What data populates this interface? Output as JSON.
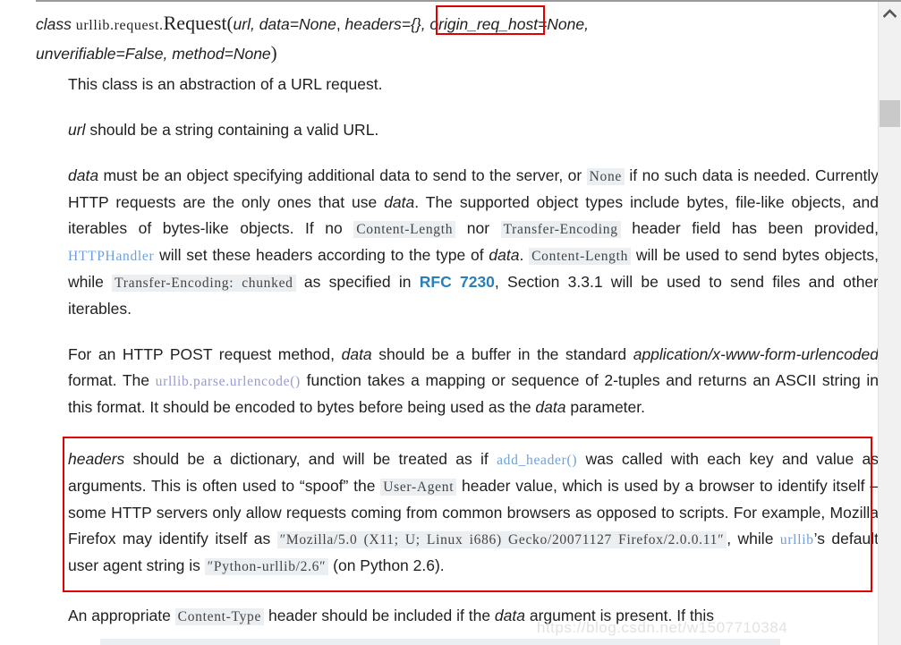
{
  "page": {
    "watermark": "https://blog.csdn.net/w1507710384"
  },
  "scrollbar": {
    "up_arrow_icon": "chevron-up-icon"
  },
  "signature": {
    "keyword": "class",
    "module_path": "urllib.request.",
    "class_name": "Request",
    "open_paren": "(",
    "args_before": "url, data=None",
    "comma_1": ", ",
    "highlighted_arg": "headers={}",
    "args_after": ", origin_req_host=None,",
    "line2": "unverifiable=False, method=None",
    "close_paren": ")"
  },
  "paragraphs": {
    "intro": "This class is an abstraction of a URL request.",
    "url_desc": {
      "param": "url",
      "rest": " should be a string containing a valid URL."
    },
    "data_desc": {
      "param": "data",
      "t1": " must be an object specifying additional data to send to the server, or ",
      "code_none": "None",
      "t2": " if no such data is needed. Currently HTTP requests are the only ones that use ",
      "param2": "data",
      "t3": ". The supported object types include bytes, file-like objects, and iterables of bytes-like objects. If no ",
      "code_content_length": "Content-Length",
      "t4": " nor ",
      "code_transfer_encoding": "Transfer-Encoding",
      "t5": " header field has been provided, ",
      "link_httphandler": "HTTPHandler",
      "t6": " will set these headers according to the type of ",
      "param3": "data",
      "t7": ". ",
      "code_content_length_2": "Content-Length",
      "t8": " will be used to send bytes objects, while ",
      "code_transfer_chunked": "Transfer-Encoding: chunked",
      "t9": " as specified in ",
      "link_rfc": "RFC 7230",
      "t10": ", Section 3.3.1 will be used to send files and other iterables."
    },
    "post_desc": {
      "t1": "For an HTTP POST request method, ",
      "param": "data",
      "t2": " should be a buffer in the standard ",
      "em_format": "application/x-www-form-urlencoded",
      "t3": " format. The ",
      "link_urlencode": "urllib.parse.urlencode()",
      "t4": " function takes a mapping or sequence of 2-tuples and returns an ASCII string in this format. It should be encoded to bytes before being used as the ",
      "param2": "data",
      "t5": " parameter."
    },
    "headers_desc": {
      "param": "headers",
      "t1": " should be a dictionary, and will be treated as if ",
      "link_add_header": "add_header()",
      "t2": " was called with each key and value as arguments. This is often used to “spoof” the ",
      "code_user_agent": "User-Agent",
      "t3": " header value, which is used by a browser to identify itself – some HTTP servers only allow requests coming from common browsers as opposed to scripts. For example, Mozilla Firefox may identify itself as ",
      "code_mozilla_ua": "″Mozilla/5.0 (X11; U; Linux i686) Gecko/20071127 Firefox/2.0.0.11″",
      "t4": ", while ",
      "link_urllib": "urllib",
      "t5": "’s default user agent string is ",
      "code_python_ua": "″Python-urllib/2.6″",
      "t6": " (on Python 2.6)."
    },
    "content_type_desc": {
      "t1": "An appropriate ",
      "code_content_type": "Content-Type",
      "t2": " header should be included if the ",
      "param": "data",
      "t3": " argument is present. If this"
    }
  },
  "colors": {
    "annotation_red": "#e00000",
    "link_blue": "#2980b9",
    "code_link_blue": "#6f9fd8",
    "code_link_violet": "#9a9ad0",
    "code_bg": "#eceff1",
    "scrollbar_track": "#f1f1f1",
    "scrollbar_thumb": "#c9c9c9"
  }
}
